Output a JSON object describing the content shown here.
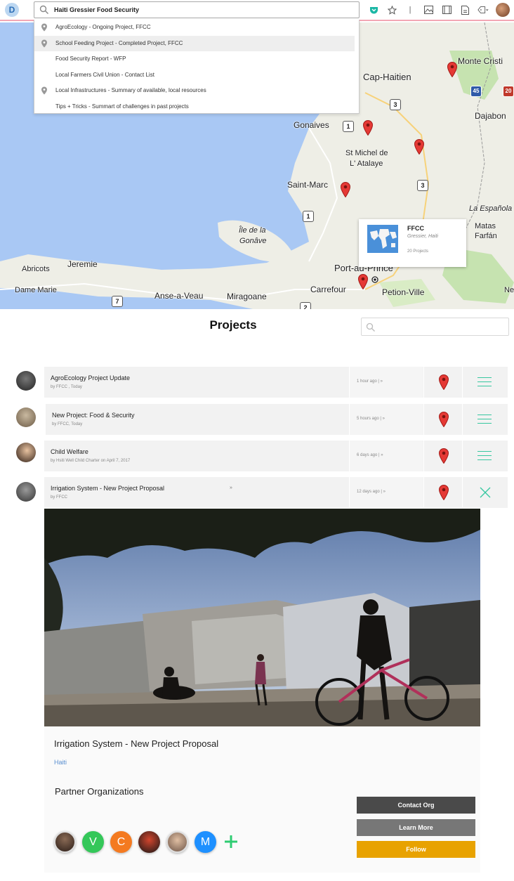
{
  "browser": {
    "app_logo": "D",
    "search_value": "Haiti Gressier Food Security",
    "toolbar_icons": [
      "pocket-icon",
      "star-icon",
      "separator",
      "image-icon",
      "film-icon",
      "document-icon",
      "tag-icon",
      "avatar"
    ],
    "separator": "|"
  },
  "suggestions": [
    {
      "label": "AgroEcology - Ongoing Project, FFCC",
      "pin": true,
      "highlight": false
    },
    {
      "label": "School Feeding Project - Completed Project, FFCC",
      "pin": true,
      "highlight": true
    },
    {
      "label": "Food Security Report - WFP",
      "pin": false,
      "highlight": false
    },
    {
      "label": "Local Farmers Civil Union - Contact List",
      "pin": false,
      "highlight": false
    },
    {
      "label": "Local Infrastructures - Summary of available, local resources",
      "pin": true,
      "highlight": false
    },
    {
      "label": "Tips + Tricks  - Summart of challenges in past projects",
      "pin": false,
      "highlight": false
    }
  ],
  "map": {
    "labels": {
      "monte_cristi": "Monte Cristi",
      "cap_haitien": "Cap-Haitien",
      "dajabon": "Dajabon",
      "gonaives": "Gonaives",
      "st_michel_1": "St Michel de",
      "st_michel_2": "L' Atalaye",
      "saint_marc": "Saint-Marc",
      "la_espanola": "La Española",
      "matas": "Matas",
      "farfan": "Farfán",
      "ile_1": "Île de la",
      "ile_2": "Gonâve",
      "jeremie": "Jeremie",
      "abricots": "Abricots",
      "dame_marie": "Dame Marie",
      "anse_a_veau": "Anse-a-Veau",
      "miragoane": "Miragoane",
      "port_au_prince": "Port-au-Prince",
      "carrefour": "Carrefour",
      "petion_ville": "Petion-Ville",
      "ne": "Ne"
    },
    "shields": {
      "r45": "45",
      "r3a": "3",
      "r1a": "1",
      "r3b": "3",
      "r1b": "1",
      "r7": "7",
      "r2": "2",
      "r20": "20"
    },
    "info_card": {
      "org": "FFCC",
      "location": "Gressier, Haiti",
      "count": "20 Projects"
    }
  },
  "projects": {
    "title": "Projects",
    "search_placeholder": "",
    "rows": [
      {
        "title": "AgroEcology Project Update",
        "sub": "by FFCC , Today",
        "time": "1 hour ago | »",
        "extra": "",
        "action": "menu"
      },
      {
        "title": "New Project:  Food & Security",
        "sub": "by FFCC, Today",
        "time": "5 hours ago | »",
        "extra": "",
        "action": "menu"
      },
      {
        "title": "Child Welfare",
        "sub": "by Hsiti Well Child Charter on  April 7, 2017",
        "time": "6 days ago | »",
        "extra": "",
        "action": "menu"
      },
      {
        "title": "Irrigation System - New Project Proposal",
        "sub": "by FFCC",
        "time": "12 days ago | »",
        "extra": "»",
        "action": "close"
      }
    ]
  },
  "detail": {
    "title": "Irrigation System - New Project Proposal",
    "region": "Haiti",
    "partners_title": "Partner Organizations",
    "partners": [
      {
        "kind": "photo",
        "label": ""
      },
      {
        "kind": "letter",
        "label": "V",
        "color": "#34c759"
      },
      {
        "kind": "letter",
        "label": "C",
        "color": "#f47a20"
      },
      {
        "kind": "photo",
        "label": ""
      },
      {
        "kind": "photo",
        "label": ""
      },
      {
        "kind": "letter",
        "label": "M",
        "color": "#1e90ff"
      }
    ],
    "buttons": {
      "contact": "Contact Org",
      "learn": "Learn More",
      "follow": "Follow"
    }
  },
  "colors": {
    "accent_teal": "#38c7a0",
    "follow_orange": "#e8a200",
    "marker_red": "#e53935",
    "link_blue": "#5a8fd0",
    "add_green": "#2ecc71"
  }
}
